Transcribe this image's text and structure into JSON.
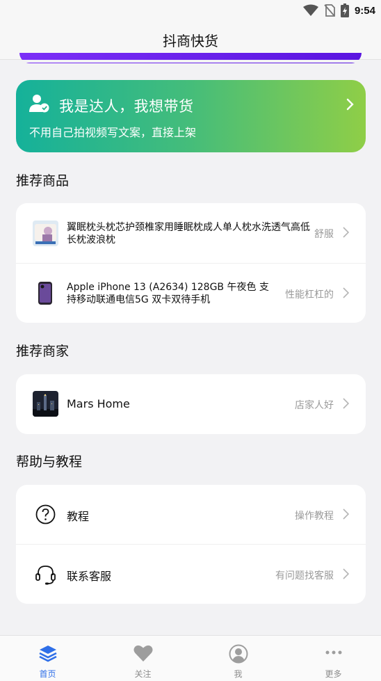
{
  "status": {
    "time": "9:54"
  },
  "app": {
    "title": "抖商快货"
  },
  "promo": {
    "title": "我是达人，我想带货",
    "subtitle": "不用自己拍视频写文案，直接上架"
  },
  "sections": {
    "products_title": "推荐商品",
    "merchants_title": "推荐商家",
    "help_title": "帮助与教程"
  },
  "products": [
    {
      "title": "翼眠枕头枕芯护颈椎家用睡眠枕成人单人枕水洗透气高低长枕波浪枕",
      "meta": "舒服"
    },
    {
      "title": "Apple iPhone 13 (A2634) 128GB 午夜色 支持移动联通电信5G 双卡双待手机",
      "meta": "性能杠杠的"
    }
  ],
  "merchants": [
    {
      "name": "Mars Home",
      "meta": "店家人好"
    }
  ],
  "help": [
    {
      "label": "教程",
      "meta": "操作教程",
      "icon": "question-circle-icon"
    },
    {
      "label": "联系客服",
      "meta": "有问题找客服",
      "icon": "headset-icon"
    }
  ],
  "tabs": [
    {
      "label": "首页",
      "icon": "layers-icon",
      "active": true
    },
    {
      "label": "关注",
      "icon": "heart-icon",
      "active": false
    },
    {
      "label": "我",
      "icon": "user-icon",
      "active": false
    },
    {
      "label": "更多",
      "icon": "more-icon",
      "active": false
    }
  ],
  "colors": {
    "accent": "#2f6fe8",
    "promo_start": "#15b19a",
    "promo_end": "#8fce47",
    "banner_purple": "#7b2ff7"
  }
}
